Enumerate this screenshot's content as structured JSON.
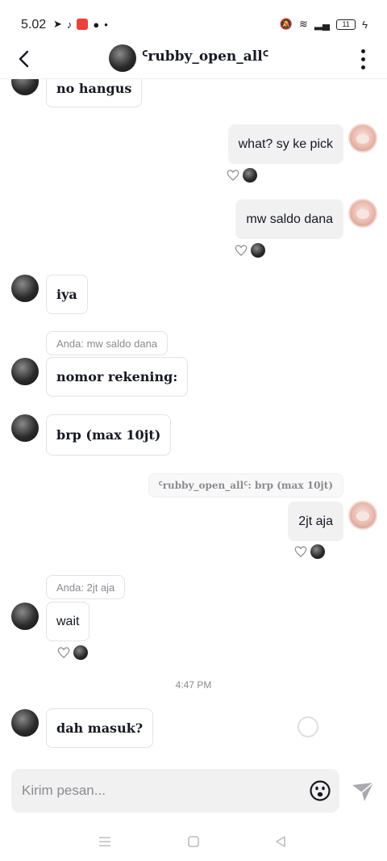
{
  "status_bar": {
    "time": "5.02",
    "battery": "11"
  },
  "header": {
    "title": "ᑦrubby_open_allᑦ"
  },
  "messages": {
    "m1": {
      "text": "no hangus"
    },
    "m2": {
      "text": "what? sy ke pick"
    },
    "m3": {
      "text": "mw saldo dana"
    },
    "m4": {
      "text": "iya"
    },
    "reply1": {
      "text": "Anda: mw saldo dana"
    },
    "m5": {
      "text": "nomor rekening:"
    },
    "m6": {
      "text": "brp (max 10jt)"
    },
    "reply2": {
      "text": "ᑦrubby_open_allᑦ: brp (max 10jt)"
    },
    "m7": {
      "text": "2jt aja"
    },
    "reply3": {
      "text": "Anda: 2jt aja"
    },
    "m8": {
      "text": "wait"
    },
    "time_divider": "4:47 PM",
    "m9": {
      "text": "dah masuk?"
    }
  },
  "input": {
    "placeholder": "Kirim pesan..."
  },
  "icons": {
    "back": "chevron-left-icon",
    "more": "more-vertical-icon",
    "heart": "heart-icon",
    "emoji": "emoji-icon",
    "send": "send-icon"
  },
  "colors": {
    "bubble_out": "#f1f1f2",
    "text_primary": "#161823",
    "text_secondary": "#8a8b91"
  }
}
